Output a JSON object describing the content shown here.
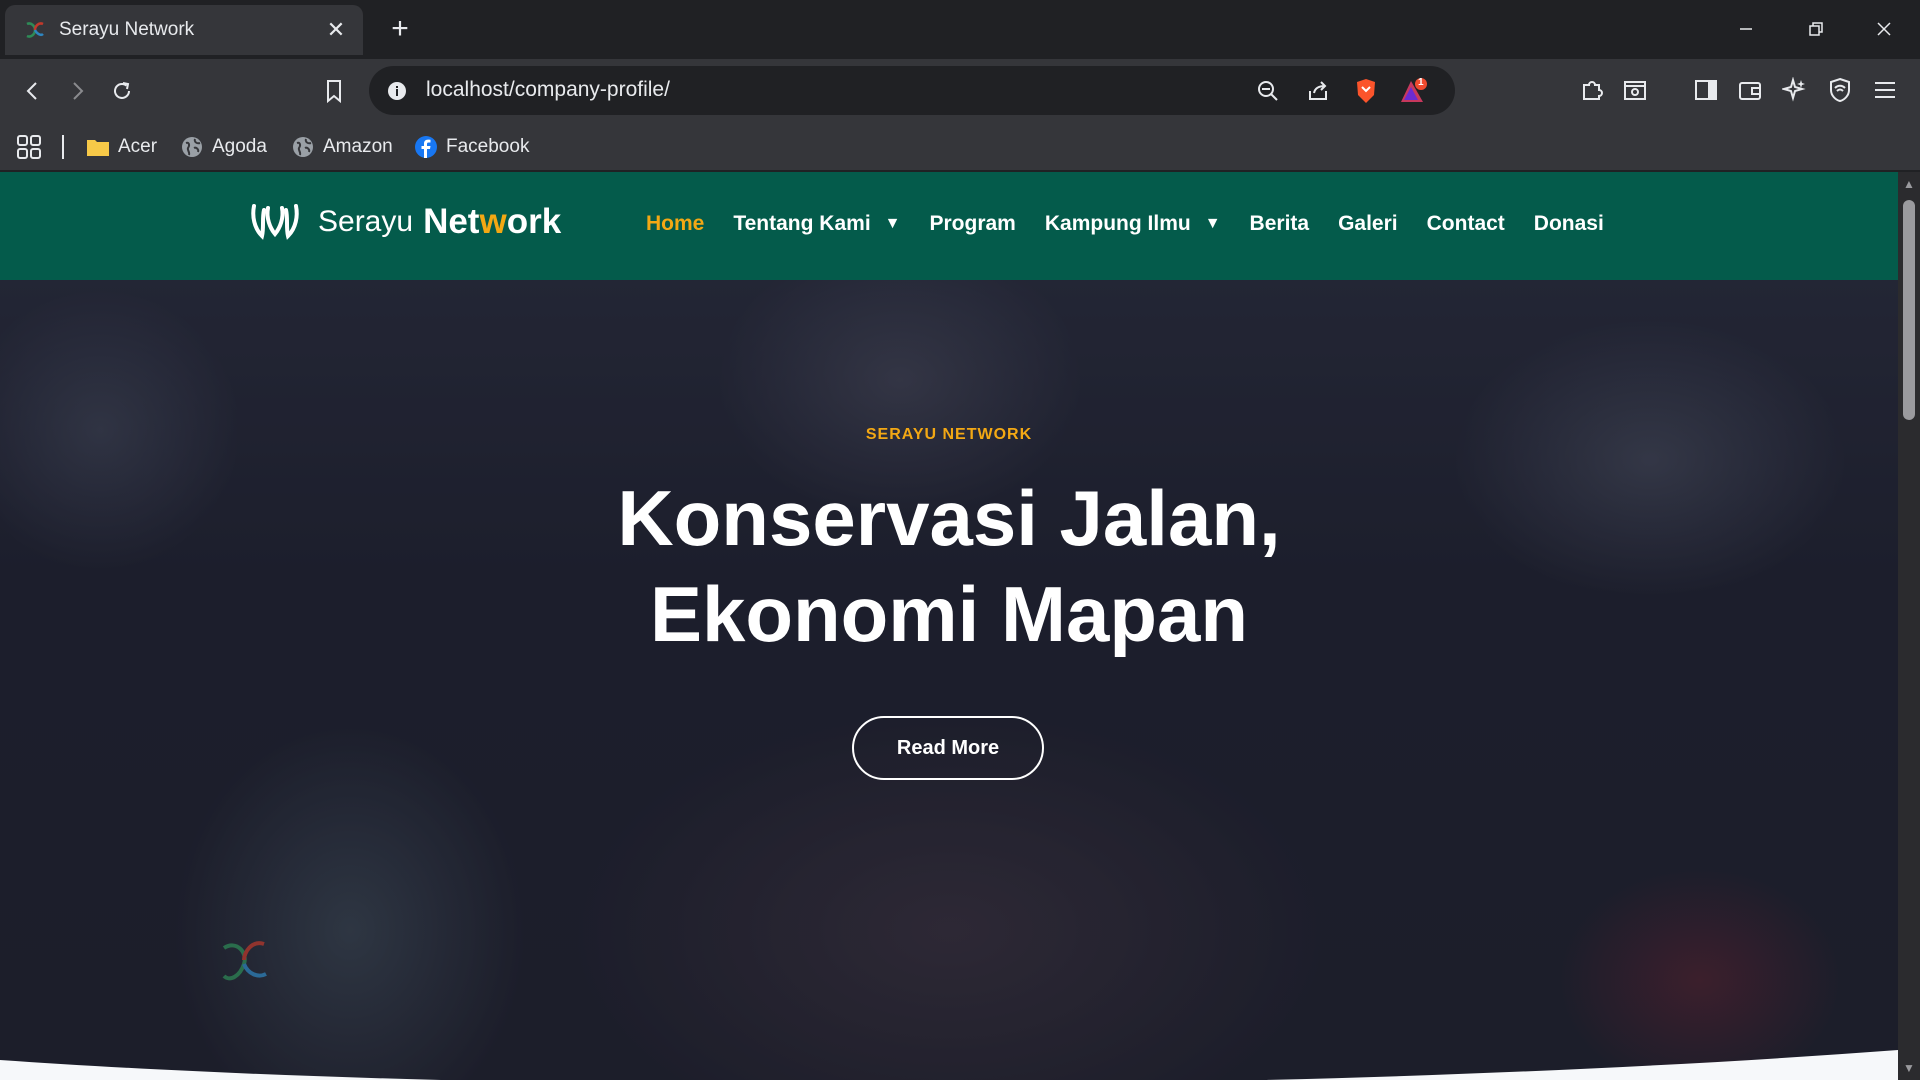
{
  "tab": {
    "title": "Serayu Network",
    "close": "✕"
  },
  "newtab": "+",
  "omnibox": {
    "url": "localhost/company-profile/",
    "badge": "1"
  },
  "bookmarks": [
    {
      "label": "Acer"
    },
    {
      "label": "Agoda"
    },
    {
      "label": "Amazon"
    },
    {
      "label": "Facebook"
    }
  ],
  "site": {
    "logo_light": "Serayu",
    "logo_bold_pre": "Net",
    "logo_bold_w": "w",
    "logo_bold_post": "ork",
    "menu": [
      {
        "label": "Home",
        "active": true
      },
      {
        "label": "Tentang Kami",
        "dropdown": true
      },
      {
        "label": "Program"
      },
      {
        "label": "Kampung Ilmu",
        "dropdown": true
      },
      {
        "label": "Berita"
      },
      {
        "label": "Galeri"
      },
      {
        "label": "Contact"
      },
      {
        "label": "Donasi"
      }
    ],
    "caret": "▼"
  },
  "hero": {
    "eyebrow": "SERAYU NETWORK",
    "headline_line1": "Konservasi Jalan,",
    "headline_line2": "Ekonomi Mapan",
    "cta": "Read More"
  },
  "colors": {
    "navbar": "#045b4b",
    "accent": "#f3a814",
    "chrome": "#35363a"
  }
}
